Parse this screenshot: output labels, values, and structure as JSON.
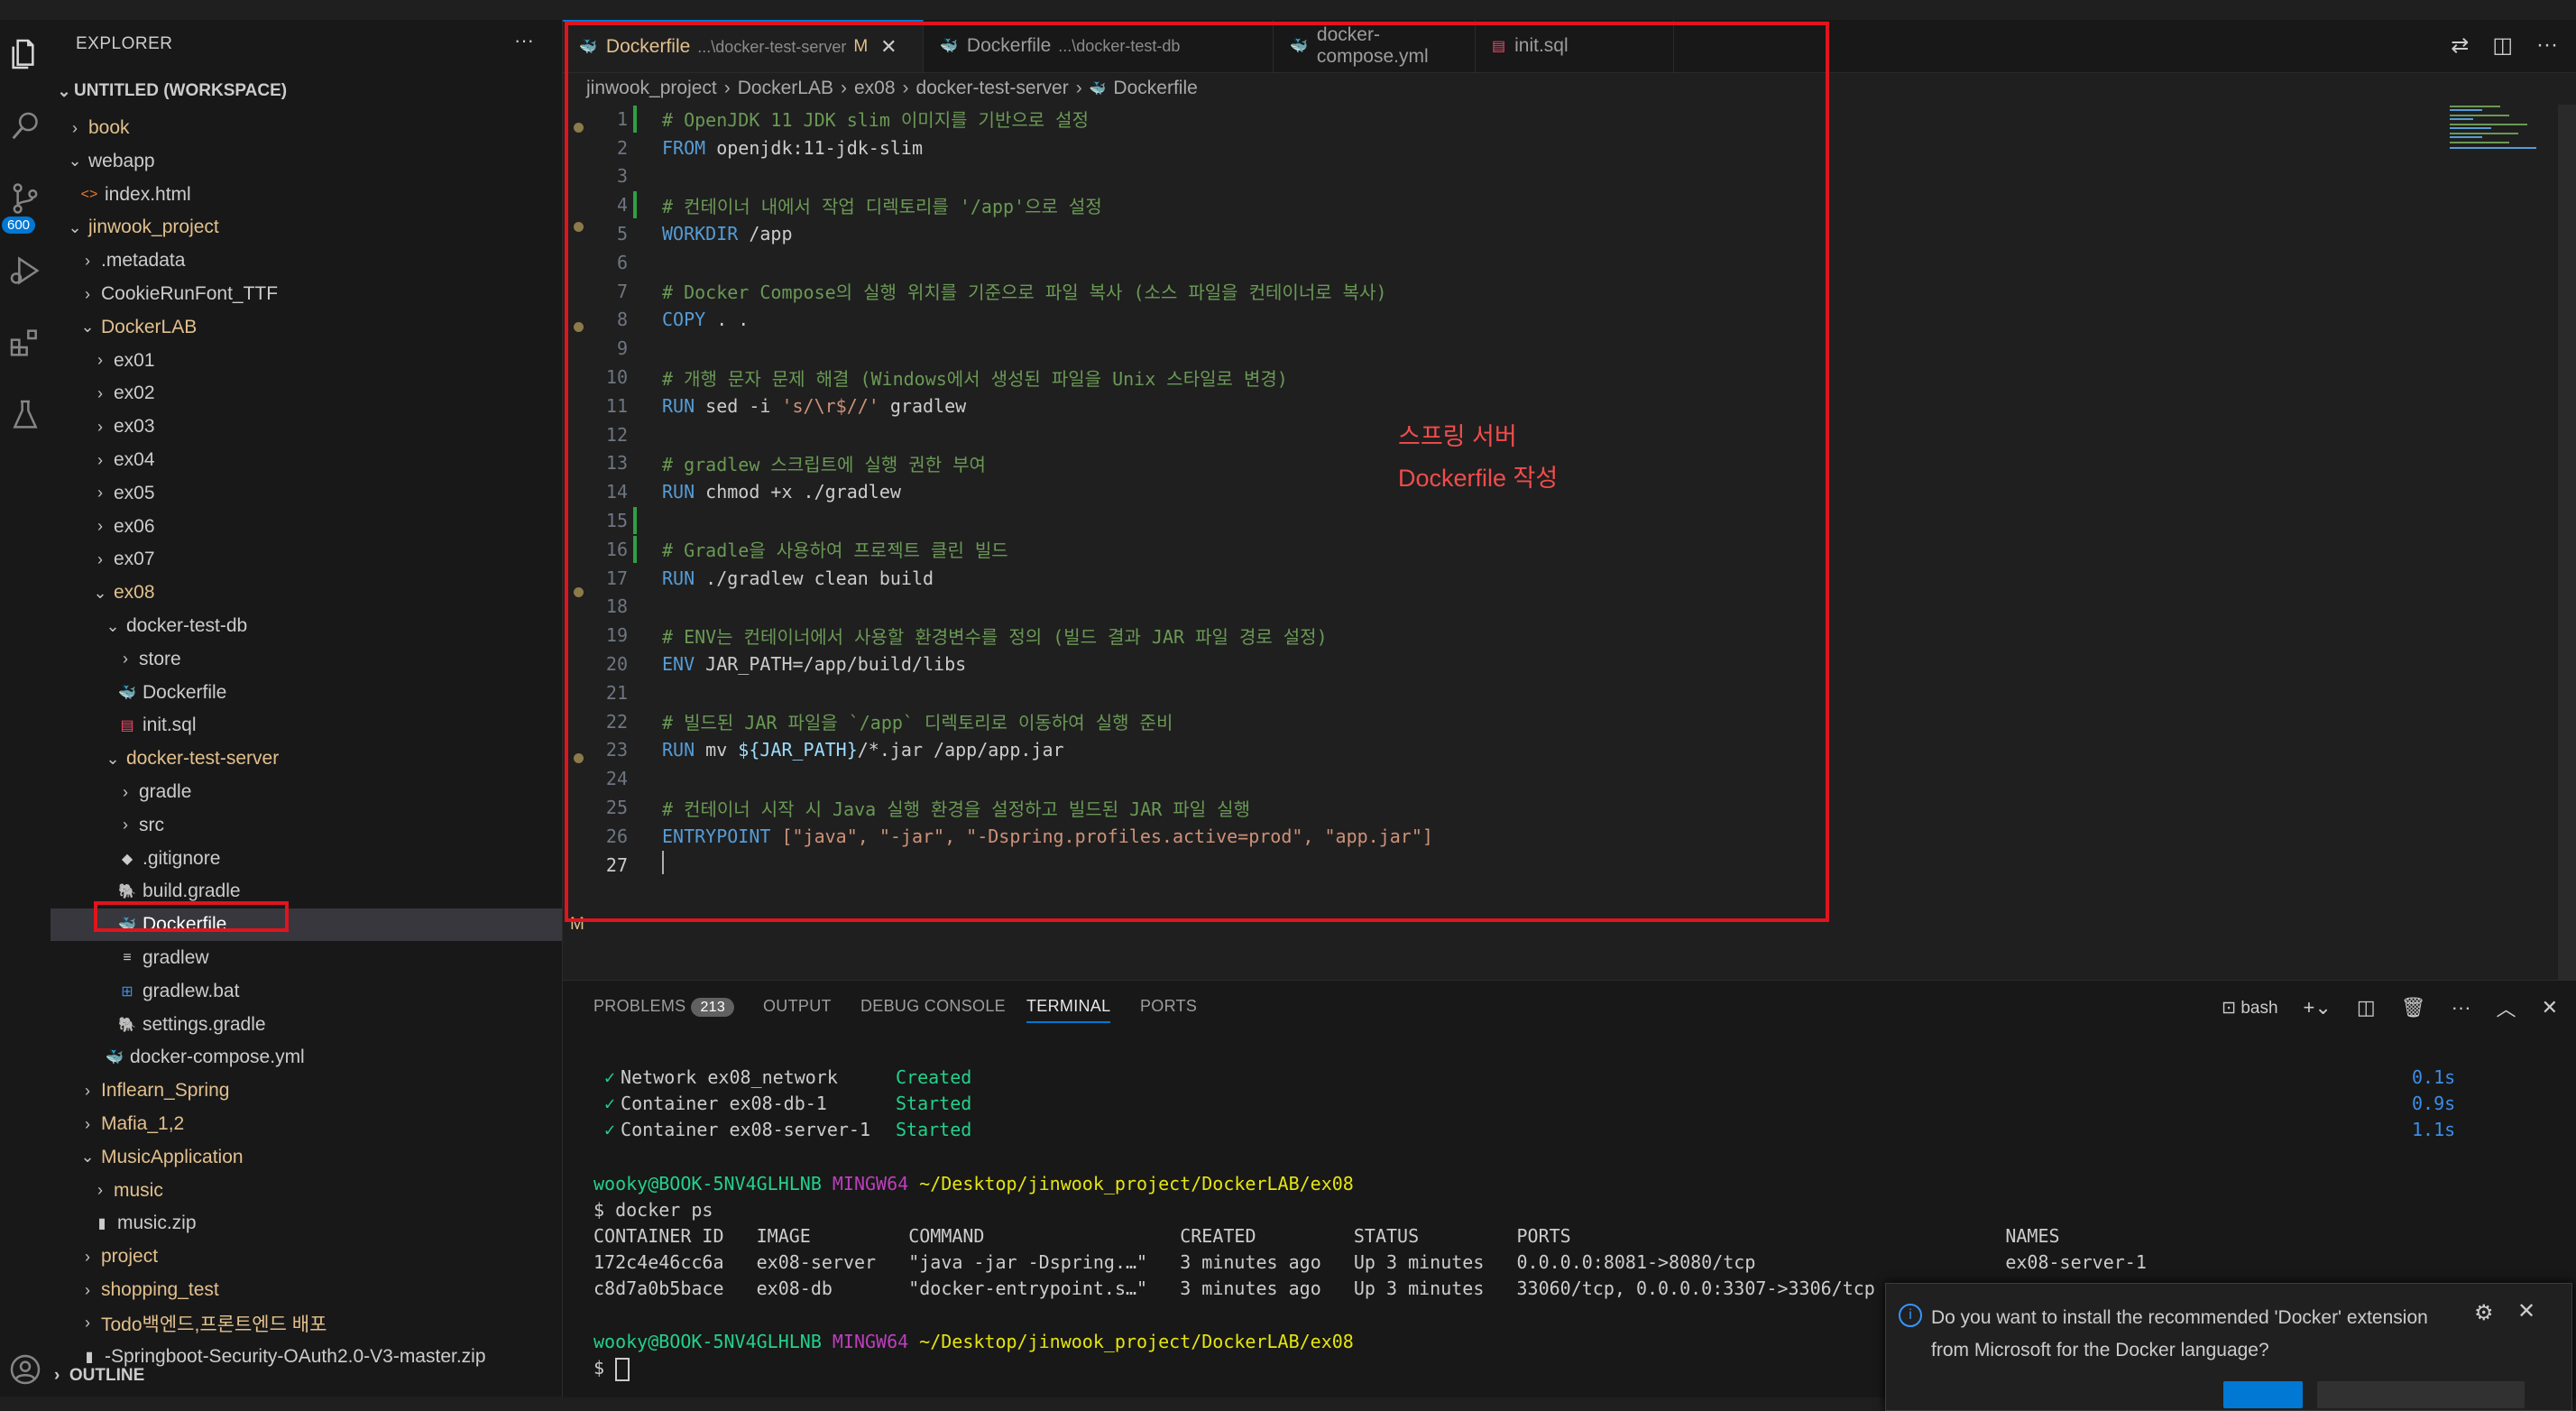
{
  "sidebar": {
    "title": "EXPLORER",
    "more": "···",
    "workspace": "UNTITLED (WORKSPACE)",
    "outline": "OUTLINE",
    "badge": "600",
    "items": [
      {
        "label": "book",
        "level": 0,
        "chev": "›",
        "icon": "",
        "color": "folder-mod",
        "dot": true
      },
      {
        "label": "webapp",
        "level": 0,
        "chev": "⌄",
        "icon": "",
        "color": "",
        "dot": false
      },
      {
        "label": "index.html",
        "level": 1,
        "chev": "",
        "icon": "<>",
        "color": "",
        "dot": false
      },
      {
        "label": "jinwook_project",
        "level": 0,
        "chev": "⌄",
        "icon": "",
        "color": "folder-mod",
        "dot": true
      },
      {
        "label": ".metadata",
        "level": 1,
        "chev": "›",
        "icon": "",
        "color": "",
        "dot": false
      },
      {
        "label": "CookieRunFont_TTF",
        "level": 1,
        "chev": "›",
        "icon": "",
        "color": "",
        "dot": false
      },
      {
        "label": "DockerLAB",
        "level": 1,
        "chev": "⌄",
        "icon": "",
        "color": "folder-mod",
        "dot": true
      },
      {
        "label": "ex01",
        "level": 2,
        "chev": "›",
        "icon": "",
        "color": "",
        "dot": false
      },
      {
        "label": "ex02",
        "level": 2,
        "chev": "›",
        "icon": "",
        "color": "",
        "dot": false
      },
      {
        "label": "ex03",
        "level": 2,
        "chev": "›",
        "icon": "",
        "color": "",
        "dot": false
      },
      {
        "label": "ex04",
        "level": 2,
        "chev": "›",
        "icon": "",
        "color": "",
        "dot": false
      },
      {
        "label": "ex05",
        "level": 2,
        "chev": "›",
        "icon": "",
        "color": "",
        "dot": false
      },
      {
        "label": "ex06",
        "level": 2,
        "chev": "›",
        "icon": "",
        "color": "",
        "dot": false
      },
      {
        "label": "ex07",
        "level": 2,
        "chev": "›",
        "icon": "",
        "color": "",
        "dot": false
      },
      {
        "label": "ex08",
        "level": 2,
        "chev": "⌄",
        "icon": "",
        "color": "folder-mod",
        "dot": true
      },
      {
        "label": "docker-test-db",
        "level": 3,
        "chev": "⌄",
        "icon": "",
        "color": "",
        "dot": false
      },
      {
        "label": "store",
        "level": 4,
        "chev": "›",
        "icon": "",
        "color": "",
        "dot": false
      },
      {
        "label": "Dockerfile",
        "level": 4,
        "chev": "",
        "icon": "🐳",
        "color": "",
        "dot": false
      },
      {
        "label": "init.sql",
        "level": 4,
        "chev": "",
        "icon": "▤",
        "color": "",
        "dot": false
      },
      {
        "label": "docker-test-server",
        "level": 3,
        "chev": "⌄",
        "icon": "",
        "color": "folder-mod",
        "dot": true
      },
      {
        "label": "gradle",
        "level": 4,
        "chev": "›",
        "icon": "",
        "color": "",
        "dot": false
      },
      {
        "label": "src",
        "level": 4,
        "chev": "›",
        "icon": "",
        "color": "",
        "dot": false
      },
      {
        "label": ".gitignore",
        "level": 4,
        "chev": "",
        "icon": "◆",
        "color": "",
        "dot": false
      },
      {
        "label": "build.gradle",
        "level": 4,
        "chev": "",
        "icon": "🐘",
        "color": "",
        "dot": false
      },
      {
        "label": "Dockerfile",
        "level": 4,
        "chev": "",
        "icon": "🐳",
        "color": "folder-mod",
        "dot": false,
        "selected": true,
        "mod": "M"
      },
      {
        "label": "gradlew",
        "level": 4,
        "chev": "",
        "icon": "≡",
        "color": "",
        "dot": false
      },
      {
        "label": "gradlew.bat",
        "level": 4,
        "chev": "",
        "icon": "⊞",
        "color": "",
        "dot": false
      },
      {
        "label": "settings.gradle",
        "level": 4,
        "chev": "",
        "icon": "🐘",
        "color": "",
        "dot": false
      },
      {
        "label": "docker-compose.yml",
        "level": 3,
        "chev": "",
        "icon": "🐳",
        "color": "",
        "dot": false
      },
      {
        "label": "Inflearn_Spring",
        "level": 1,
        "chev": "›",
        "icon": "",
        "color": "folder-mod",
        "dot": true
      },
      {
        "label": "Mafia_1,2",
        "level": 1,
        "chev": "›",
        "icon": "",
        "color": "folder-mod",
        "dot": true
      },
      {
        "label": "MusicApplication",
        "level": 1,
        "chev": "⌄",
        "icon": "",
        "color": "folder-mod",
        "dot": true
      },
      {
        "label": "music",
        "level": 2,
        "chev": "›",
        "icon": "",
        "color": "folder-mod",
        "dot": true
      },
      {
        "label": "music.zip",
        "level": 2,
        "chev": "",
        "icon": "▮",
        "color": "",
        "dot": false
      },
      {
        "label": "project",
        "level": 1,
        "chev": "›",
        "icon": "",
        "color": "folder-mod",
        "dot": true
      },
      {
        "label": "shopping_test",
        "level": 1,
        "chev": "›",
        "icon": "",
        "color": "folder-mod",
        "dot": true
      },
      {
        "label": "Todo백엔드,프론트엔드 배포",
        "level": 1,
        "chev": "›",
        "icon": "",
        "color": "folder-mod",
        "dot": true
      },
      {
        "label": "-Springboot-Security-OAuth2.0-V3-master.zip",
        "level": 1,
        "chev": "",
        "icon": "▮",
        "color": "",
        "dot": false
      }
    ]
  },
  "tabs": [
    {
      "label": "Dockerfile",
      "desc": "...\\docker-test-server",
      "mark": "M",
      "active": true,
      "close": "✕",
      "icon": "🐳"
    },
    {
      "label": "Dockerfile",
      "desc": "...\\docker-test-db",
      "mark": "",
      "active": false,
      "close": "",
      "icon": "🐳"
    },
    {
      "label": "docker-compose.yml",
      "desc": "",
      "mark": "",
      "active": false,
      "close": "",
      "icon": "🐳"
    },
    {
      "label": "init.sql",
      "desc": "",
      "mark": "",
      "active": false,
      "close": "",
      "icon": "▤"
    }
  ],
  "breadcrumb": [
    "jinwook_project",
    "DockerLAB",
    "ex08",
    "docker-test-server",
    "Dockerfile"
  ],
  "code": [
    {
      "n": "1",
      "t": "cm",
      "s": "# OpenJDK 11 JDK slim 이미지를 기반으로 설정",
      "mark": true
    },
    {
      "n": "2",
      "t": "mix",
      "kw": "FROM",
      "rest": " openjdk:11-jdk-slim"
    },
    {
      "n": "3",
      "t": "plain",
      "s": ""
    },
    {
      "n": "4",
      "t": "cm",
      "s": "# 컨테이너 내에서 작업 디렉토리를 '/app'으로 설정",
      "mark": true
    },
    {
      "n": "5",
      "t": "mix",
      "kw": "WORKDIR",
      "rest": " /app"
    },
    {
      "n": "6",
      "t": "plain",
      "s": ""
    },
    {
      "n": "7",
      "t": "cm",
      "s": "# Docker Compose의 실행 위치를 기준으로 파일 복사 (소스 파일을 컨테이너로 복사)"
    },
    {
      "n": "8",
      "t": "mix",
      "kw": "COPY",
      "rest": " . ."
    },
    {
      "n": "9",
      "t": "plain",
      "s": ""
    },
    {
      "n": "10",
      "t": "cm",
      "s": "# 개행 문자 문제 해결 (Windows에서 생성된 파일을 Unix 스타일로 변경)"
    },
    {
      "n": "11",
      "t": "mixstr",
      "kw": "RUN",
      "rest": " sed -i ",
      "str": "'s/\\r$//'",
      "rest2": " gradlew"
    },
    {
      "n": "12",
      "t": "plain",
      "s": ""
    },
    {
      "n": "13",
      "t": "cm",
      "s": "# gradlew 스크립트에 실행 권한 부여"
    },
    {
      "n": "14",
      "t": "mix",
      "kw": "RUN",
      "rest": " chmod +x ./gradlew"
    },
    {
      "n": "15",
      "t": "plain",
      "s": "",
      "mark": true
    },
    {
      "n": "16",
      "t": "cm",
      "s": "# Gradle을 사용하여 프로젝트 클린 빌드",
      "mark": true
    },
    {
      "n": "17",
      "t": "mix",
      "kw": "RUN",
      "rest": " ./gradlew clean build"
    },
    {
      "n": "18",
      "t": "plain",
      "s": ""
    },
    {
      "n": "19",
      "t": "cm",
      "s": "# ENV는 컨테이너에서 사용할 환경변수를 정의 (빌드 결과 JAR 파일 경로 설정)"
    },
    {
      "n": "20",
      "t": "mix",
      "kw": "ENV",
      "rest": " JAR_PATH=/app/build/libs"
    },
    {
      "n": "21",
      "t": "plain",
      "s": ""
    },
    {
      "n": "22",
      "t": "cm",
      "s": "# 빌드된 JAR 파일을 `/app` 디렉토리로 이동하여 실행 준비"
    },
    {
      "n": "23",
      "t": "mixvar",
      "kw": "RUN",
      "rest": " mv ",
      "var": "${JAR_PATH}",
      "rest2": "/*.jar /app/app.jar"
    },
    {
      "n": "24",
      "t": "plain",
      "s": ""
    },
    {
      "n": "25",
      "t": "cm",
      "s": "# 컨테이너 시작 시 Java 실행 환경을 설정하고 빌드된 JAR 파일 실행"
    },
    {
      "n": "26",
      "t": "entry",
      "kw": "ENTRYPOINT",
      "rest": " [\"java\", \"-jar\", \"-Dspring.profiles.active=prod\", \"app.jar\"]"
    },
    {
      "n": "27",
      "t": "cursor",
      "s": ""
    }
  ],
  "annotation": {
    "line1": "스프링 서버",
    "line2": "Dockerfile 작성"
  },
  "panel": {
    "tabs": [
      "PROBLEMS",
      "OUTPUT",
      "DEBUG CONSOLE",
      "TERMINAL",
      "PORTS"
    ],
    "problems_count": "213",
    "shell": "bash",
    "terminal": {
      "created": [
        {
          "check": "✓",
          "what": "Network ex08_network",
          "status": "Created",
          "time": "0.1s"
        },
        {
          "check": "✓",
          "what": "Container ex08-db-1",
          "status": "Started",
          "time": "0.9s"
        },
        {
          "check": "✓",
          "what": "Container ex08-server-1",
          "status": "Started",
          "time": "1.1s"
        }
      ],
      "prompt_user": "wooky@BOOK-5NV4GLHLNB",
      "prompt_env": "MINGW64",
      "prompt_path": "~/Desktop/jinwook_project/DockerLAB/ex08",
      "cmd": "$ docker ps",
      "header": "CONTAINER ID   IMAGE         COMMAND                  CREATED         STATUS         PORTS                                        NAMES",
      "row1": "172c4e46cc6a   ex08-server   \"java -jar -Dspring.…\"   3 minutes ago   Up 3 minutes   0.0.0.0:8081->8080/tcp                       ex08-server-1",
      "row2": "c8d7a0b5bace   ex08-db       \"docker-entrypoint.s…\"   3 minutes ago   Up 3 minutes   33060/tcp, 0.0.0.0:3307->3306/tcp",
      "prompt_end": "$ "
    }
  },
  "notification": {
    "text": "Do you want to install the recommended 'Docker' extension from Microsoft for the Docker language?"
  },
  "colors": {
    "accent": "#0078d4",
    "annotation": "#e0141e",
    "comment": "#6a9955",
    "keyword": "#569cd6",
    "string": "#ce9178"
  }
}
